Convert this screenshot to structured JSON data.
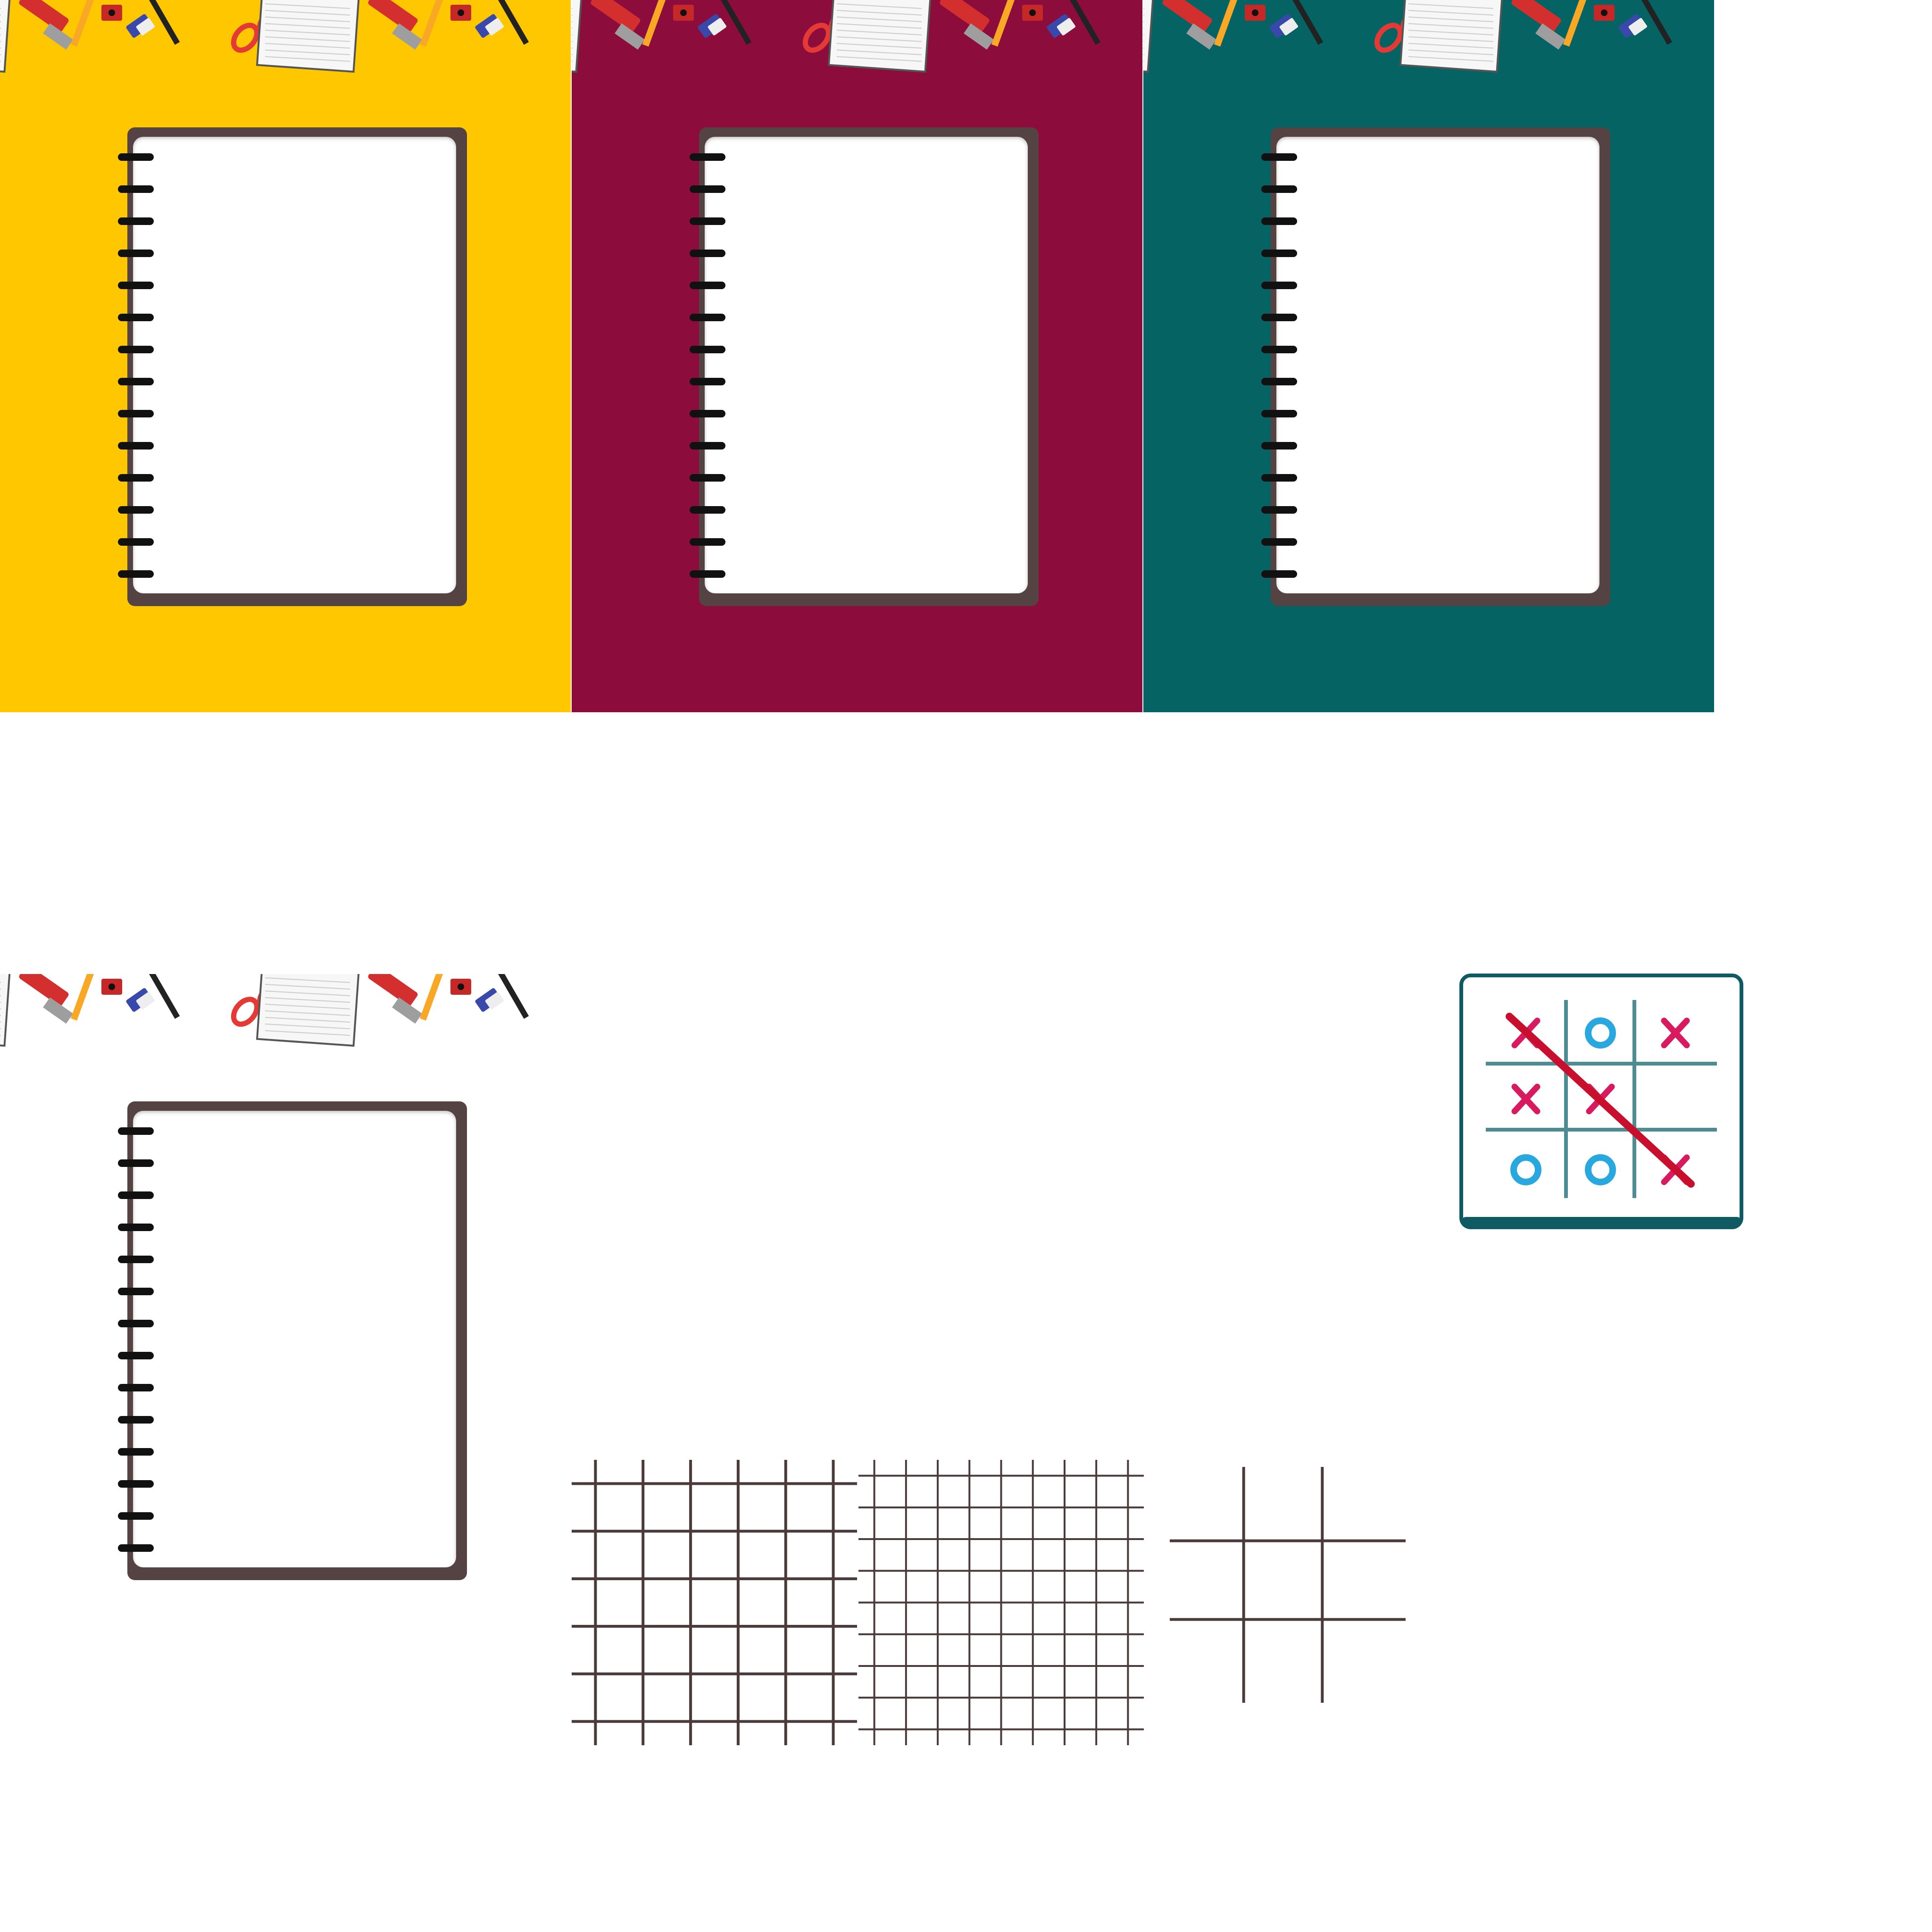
{
  "assets": {
    "panels": [
      {
        "name": "yellow-notebook-panel",
        "background": "#FEC700",
        "border_strip": true
      },
      {
        "name": "crimson-notebook-panel",
        "background": "#8C0D3C",
        "border_strip": true
      },
      {
        "name": "teal-notebook-panel",
        "background": "#066363",
        "border_strip": true
      },
      {
        "name": "white-notebook-panel",
        "background": "#FFFFFF",
        "border_strip": true
      }
    ],
    "notebook": {
      "cover_color": "#554343",
      "page_color": "#FFFFFF",
      "ring_color": "#111111",
      "ring_count": 14
    },
    "grids": [
      {
        "name": "grid-6x6",
        "lines_per_axis": 6,
        "color": "#4A3A3A"
      },
      {
        "name": "grid-9x9",
        "lines_per_axis": 9,
        "color": "#4A3A3A"
      },
      {
        "name": "grid-3x3",
        "lines_per_axis": 2,
        "color": "#4A3A3A"
      }
    ]
  },
  "game_board": {
    "cells": [
      "X",
      "O",
      "X",
      "X",
      "X",
      "",
      "O",
      "O",
      "X"
    ],
    "winning_line": "diagonal-top-left-to-bottom-right",
    "x_color": "#D81B60",
    "o_color": "#29A8E0",
    "win_line_color": "#C8102E",
    "grid_color": "#4E8C93",
    "frame_color": "#0F5A63"
  }
}
